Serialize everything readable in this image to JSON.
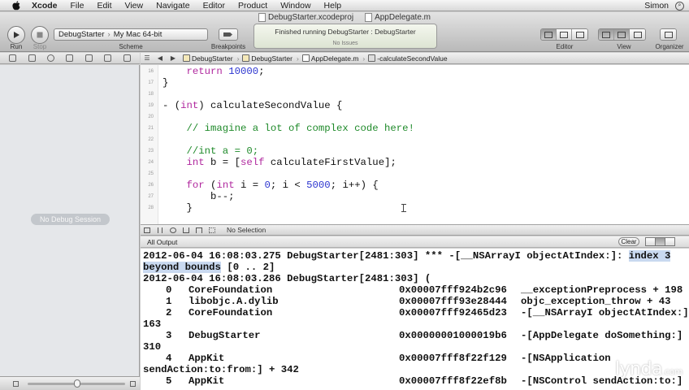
{
  "menubar": {
    "app_name": "Xcode",
    "items": [
      "File",
      "Edit",
      "View",
      "Navigate",
      "Editor",
      "Product",
      "Window",
      "Help"
    ],
    "user": "Simon"
  },
  "window": {
    "project_file": "DebugStarter.xcodeproj",
    "source_file": "AppDelegate.m"
  },
  "toolbar": {
    "run_label": "Run",
    "stop_label": "Stop",
    "scheme_target": "DebugStarter",
    "scheme_destination": "My Mac 64-bit",
    "scheme_label": "Scheme",
    "breakpoints_label": "Breakpoints",
    "activity_status": "Finished running DebugStarter : DebugStarter",
    "activity_issues": "No Issues",
    "editor_label": "Editor",
    "view_label": "View",
    "organizer_label": "Organizer"
  },
  "navigator": {
    "no_debug_label": "No Debug Session"
  },
  "jumpbar": {
    "crumbs": [
      "DebugStarter",
      "DebugStarter",
      "AppDelegate.m",
      "-calculateSecondValue"
    ]
  },
  "editor": {
    "lines": [
      {
        "n": "16",
        "text": "    return 10000;"
      },
      {
        "n": "17",
        "text": "}"
      },
      {
        "n": "18",
        "text": ""
      },
      {
        "n": "19",
        "text": "- (int) calculateSecondValue {"
      },
      {
        "n": "20",
        "text": ""
      },
      {
        "n": "21",
        "text": "    // imagine a lot of complex code here!"
      },
      {
        "n": "22",
        "text": ""
      },
      {
        "n": "23",
        "text": "    //int a = 0;"
      },
      {
        "n": "24",
        "text": "    int b = [self calculateFirstValue];"
      },
      {
        "n": "25",
        "text": ""
      },
      {
        "n": "26",
        "text": "    for (int i = 0; i < 5000; i++) {"
      },
      {
        "n": "27",
        "text": "        b--;"
      },
      {
        "n": "28",
        "text": "    }"
      }
    ]
  },
  "debugbar": {
    "selection_label": "No Selection"
  },
  "console": {
    "filter_label": "All Output",
    "clear_label": "Clear",
    "lines": [
      "2012-06-04 16:08:03.275 DebugStarter[2481:303] *** -[__NSArrayI objectAtIndex:]: index 3",
      "beyond bounds [0 .. 2]",
      "2012-06-04 16:08:03.286 DebugStarter[2481:303] ("
    ],
    "frames": [
      {
        "num": "0",
        "lib": "CoreFoundation",
        "addr": "0x00007fff924b2c96",
        "sym": "__exceptionPreprocess + 198",
        "cont": ""
      },
      {
        "num": "1",
        "lib": "libobjc.A.dylib",
        "addr": "0x00007fff93e28444",
        "sym": "objc_exception_throw + 43",
        "cont": ""
      },
      {
        "num": "2",
        "lib": "CoreFoundation",
        "addr": "0x00007fff92465d23",
        "sym": "-[__NSArrayI objectAtIndex:] +",
        "cont": "163"
      },
      {
        "num": "3",
        "lib": "DebugStarter",
        "addr": "0x00000001000019b6",
        "sym": "-[AppDelegate doSomething:] +",
        "cont": "310"
      },
      {
        "num": "4",
        "lib": "AppKit",
        "addr": "0x00007fff8f22f129",
        "sym": "-[NSApplication",
        "cont": "sendAction:to:from:] + 342"
      },
      {
        "num": "5",
        "lib": "AppKit",
        "addr": "0x00007fff8f22ef8b",
        "sym": "-[NSControl sendAction:to:] +",
        "cont": ""
      }
    ]
  },
  "watermark": {
    "brand": "lynda",
    "suffix": ".com"
  },
  "colors": {
    "keyword": "#b0289e",
    "number": "#2b34cf",
    "comment": "#1f8a2a",
    "highlight": "#c9d9f0"
  }
}
